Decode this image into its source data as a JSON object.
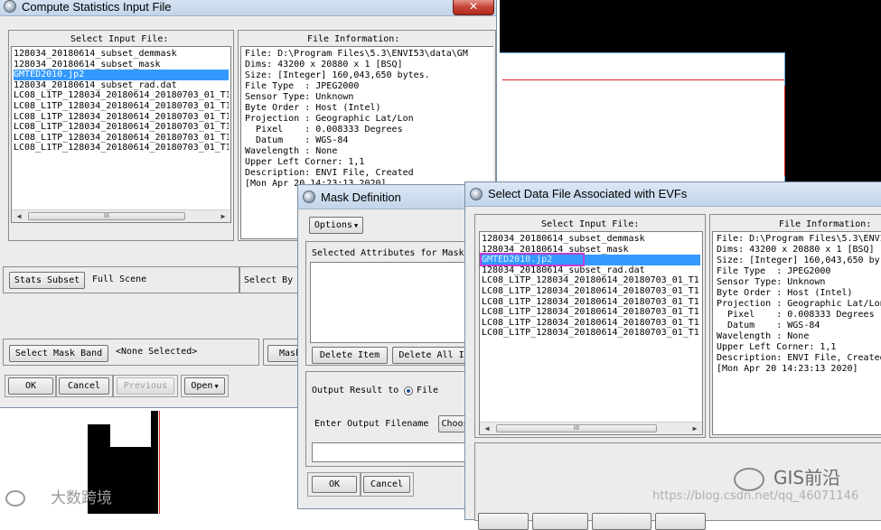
{
  "windows": {
    "compute": {
      "title": "Compute Statistics Input File",
      "close_label": "✕",
      "select_input_label": "Select Input File:",
      "files": [
        "128034_20180614_subset_demmask",
        "128034_20180614_subset_mask",
        "GMTED2010.jp2",
        "128034_20180614_subset_rad.dat",
        "LC08_L1TP_128034_20180614_20180703_01_T1.",
        "LC08_L1TP_128034_20180614_20180703_01_T1.",
        "LC08_L1TP_128034_20180614_20180703_01_T1.",
        "LC08_L1TP_128034_20180614_20180703_01_T1.",
        "LC08_L1TP_128034_20180614_20180703_01_T1.",
        "LC08_L1TP_128034_20180614_20180703_01_T1."
      ],
      "selected_index": 2,
      "file_info_label": "File Information:",
      "file_info": [
        "File: D:\\Program Files\\5.3\\ENVI53\\data\\GM",
        "Dims: 43200 x 20880 x 1 [BSQ]",
        "Size: [Integer] 160,043,650 bytes.",
        "File Type  : JPEG2000",
        "Sensor Type: Unknown",
        "Byte Order : Host (Intel)",
        "Projection : Geographic Lat/Lon",
        "  Pixel    : 0.008333 Degrees",
        "  Datum    : WGS-84",
        "Wavelength : None",
        "Upper Left Corner: 1,1",
        "Description: ENVI File, Created",
        "[Mon Apr 20 14:23:13 2020]"
      ],
      "stats_subset_label": "Stats Subset",
      "stats_subset_value": "Full Scene",
      "select_by_label": "Select By",
      "select_mask_band_label": "Select Mask Band",
      "mask_band_value": "<None Selected>",
      "mask_options_label": "Mask",
      "ok_label": "OK",
      "cancel_label": "Cancel",
      "previous_label": "Previous",
      "open_label": "Open"
    },
    "mask": {
      "title": "Mask Definition",
      "options_label": "Options",
      "selected_attributes_label": "Selected Attributes for Mask",
      "delete_item_label": "Delete Item",
      "delete_all_label": "Delete All I",
      "output_result_label": "Output Result to",
      "file_radio_label": "File",
      "enter_output_label": "Enter Output Filename",
      "choose_label": "Choos",
      "ok_label": "OK",
      "cancel_label": "Cancel"
    },
    "evf": {
      "title": "Select Data File Associated with EVFs",
      "select_input_label": "Select Input File:",
      "files": [
        "128034_20180614_subset_demmask",
        "128034_20180614_subset_mask",
        "GMTED2010.jp2",
        "128034_20180614_subset_rad.dat",
        "LC08_L1TP_128034_20180614_20180703_01_T1",
        "LC08_L1TP_128034_20180614_20180703_01_T1",
        "LC08_L1TP_128034_20180614_20180703_01_T1",
        "LC08_L1TP_128034_20180614_20180703_01_T1",
        "LC08_L1TP_128034_20180614_20180703_01_T1",
        "LC08_L1TP_128034_20180614_20180703_01_T1"
      ],
      "selected_index": 2,
      "file_info_label": "File Information:",
      "file_info": [
        "File: D:\\Program Files\\5.3\\ENVI",
        "Dims: 43200 x 20880 x 1 [BSQ]",
        "Size: [Integer] 160,043,650 by",
        "File Type  : JPEG2000",
        "Sensor Type: Unknown",
        "Byte Order : Host (Intel)",
        "Projection : Geographic Lat/Lon",
        "  Pixel    : 0.008333 Degrees",
        "  Datum    : WGS-84",
        "Wavelength : None",
        "Upper Left Corner: 1,1",
        "Description: ENVI File, Created",
        "[Mon Apr 20 14:23:13 2020]"
      ]
    }
  },
  "watermarks": {
    "bottom_left": "大数跨境",
    "bottom_right": "GIS前沿",
    "url": "https://blog.csdn.net/qq_46071146"
  },
  "colors": {
    "selection": "#3399ff",
    "highlight_box": "#c23fd6",
    "close_button": "#c7463a",
    "title_bar": "#c3d5ea"
  }
}
